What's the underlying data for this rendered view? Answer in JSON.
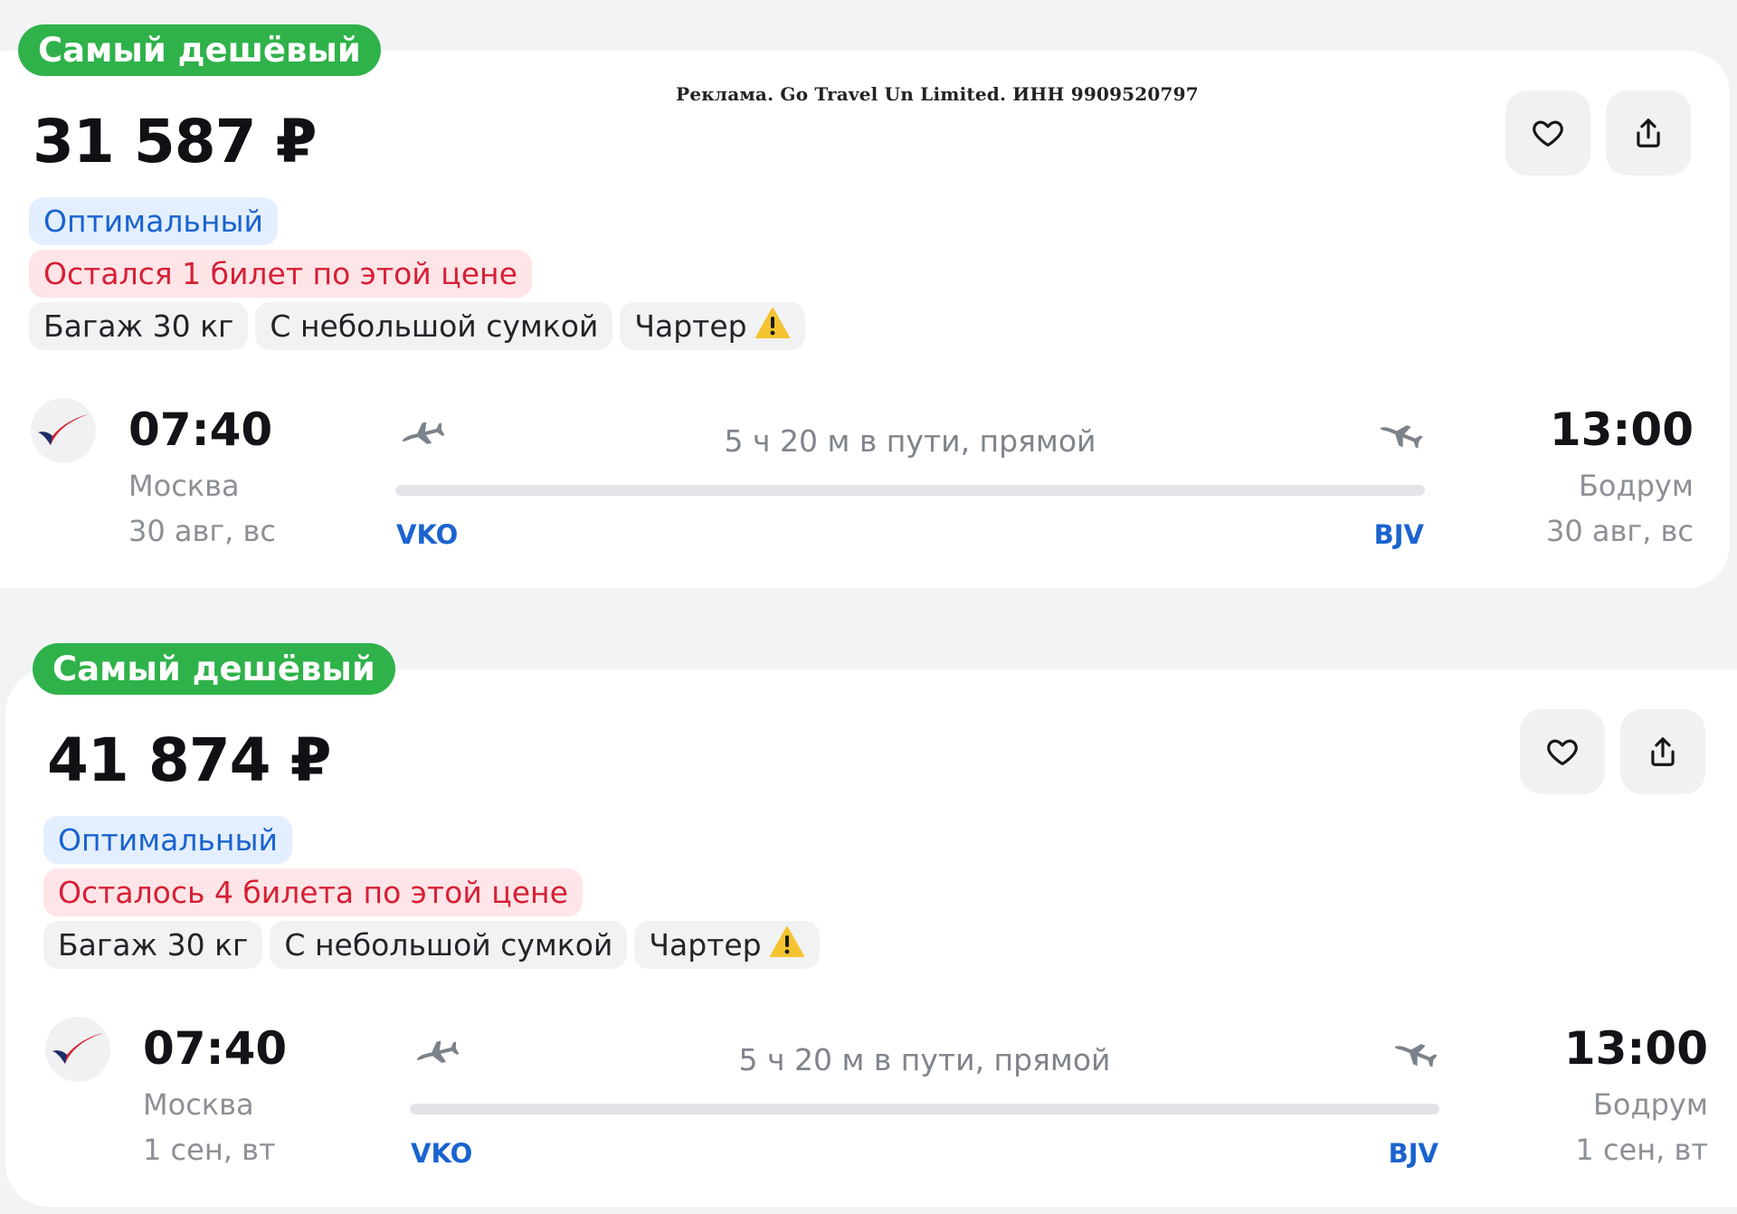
{
  "ad_notice": "Реклама. Go Travel Un Limited. ИНН 9909520797",
  "colors": {
    "badge_green": "#2fb24a",
    "accent_blue": "#1a63cf",
    "alert_red": "#d61f35",
    "warning_yellow": "#f4c430"
  },
  "icons": {
    "favorite": "heart-icon",
    "share": "share-icon",
    "warning": "warning-icon",
    "takeoff": "plane-takeoff-icon",
    "landing": "plane-landing-icon",
    "airline": "airline-logo"
  },
  "offers": [
    {
      "badge": "Самый дешёвый",
      "price": "31 587 ₽",
      "tag_optimal": "Оптимальный",
      "tag_tickets_left": "Остался 1 билет по этой цене",
      "features": [
        "Багаж 30 кг",
        "С небольшой сумкой",
        "Чартер"
      ],
      "departure": {
        "time": "07:40",
        "city": "Москва",
        "date": "30 авг, вс",
        "iata": "VKO"
      },
      "arrival": {
        "time": "13:00",
        "city": "Бодрум",
        "date": "30 авг, вс",
        "iata": "BJV"
      },
      "duration": "5 ч 20 м в пути, прямой"
    },
    {
      "badge": "Самый дешёвый",
      "price": "41 874 ₽",
      "tag_optimal": "Оптимальный",
      "tag_tickets_left": "Осталось 4 билета по этой цене",
      "features": [
        "Багаж 30 кг",
        "С небольшой сумкой",
        "Чартер"
      ],
      "departure": {
        "time": "07:40",
        "city": "Москва",
        "date": "1 сен, вт",
        "iata": "VKO"
      },
      "arrival": {
        "time": "13:00",
        "city": "Бодрум",
        "date": "1 сен, вт",
        "iata": "BJV"
      },
      "duration": "5 ч 20 м в пути, прямой"
    }
  ]
}
